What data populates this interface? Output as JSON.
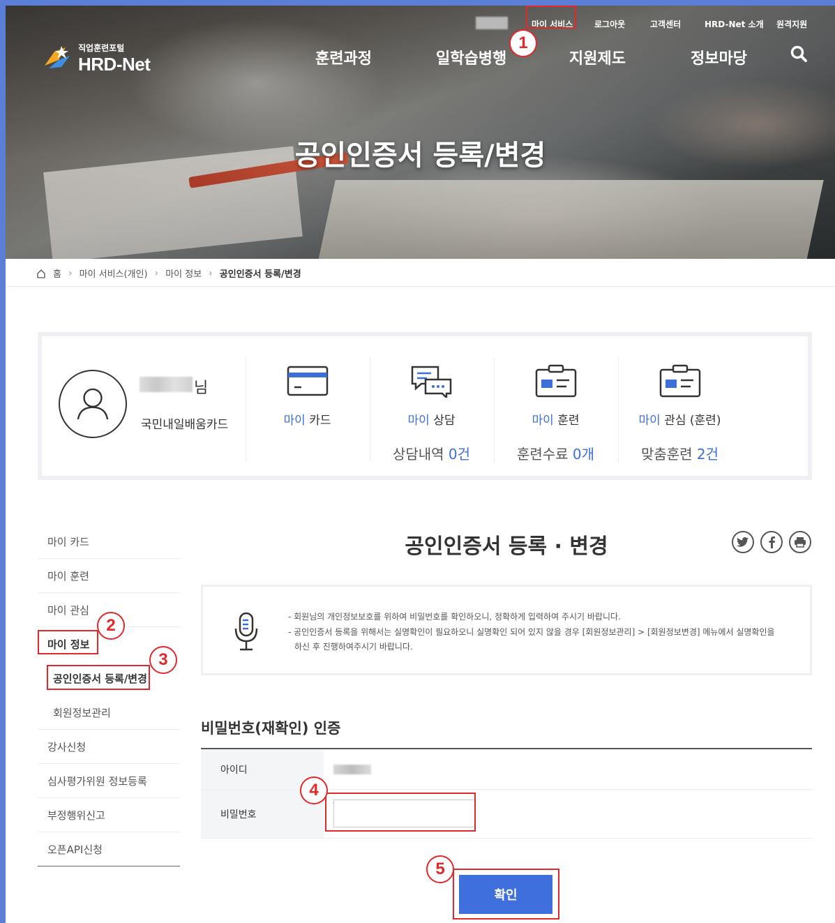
{
  "header": {
    "logo_sub": "직업훈련포털",
    "logo_main": "HRD-Net",
    "util_links": [
      "마이 서비스",
      "로그아웃",
      "고객센터",
      "HRD-Net 소개",
      "원격지원"
    ],
    "gnb": [
      "훈련과정",
      "일학습병행",
      "지원제도",
      "정보마당"
    ],
    "hero_title": "공인인증서 등록/변경"
  },
  "breadcrumb": {
    "home": "홈",
    "items": [
      "마이 서비스(개인)",
      "마이 정보",
      "공인인증서 등록/변경"
    ]
  },
  "profile": {
    "name_suffix": "님",
    "card_type": "국민내일배움카드"
  },
  "summary": [
    {
      "accent": "마이",
      "label": "카드",
      "icon": "card-icon",
      "stat": "",
      "count": ""
    },
    {
      "accent": "마이",
      "label": "상담",
      "icon": "chat-icon",
      "stat": "상담내역",
      "count": "0건"
    },
    {
      "accent": "마이",
      "label": "훈련",
      "icon": "id-card-icon",
      "stat": "훈련수료",
      "count": "0개"
    },
    {
      "accent": "마이",
      "label": "관심 (훈련)",
      "icon": "id-card-icon",
      "stat": "맞춤훈련",
      "count": "2건"
    }
  ],
  "lnb": {
    "items": [
      "마이 카드",
      "마이 훈련",
      "마이 관심",
      "마이 정보",
      "공인인증서 등록/변경",
      "회원정보관리",
      "강사신청",
      "심사평가위원 정보등록",
      "부정행위신고",
      "오픈API신청"
    ]
  },
  "content": {
    "title": "공인인증서 등록 · 변경",
    "notice1": "- 회원님의 개인정보보호를 위하여 비밀번호를 확인하오니, 정확하게 입력하여 주시기 바랍니다.",
    "notice2a": "- 공인인증서 등록을 위해서는 실명확인이 필요하오니 실명확인 되어 있지 않을 경우 [회원정보관리] > [회원정보변경] 메뉴에서 실명확인을",
    "notice2b": "하신 후 진행하여주시기 바랍니다.",
    "section_title": "비밀번호(재확인) 인증",
    "id_label": "아이디",
    "pw_label": "비밀번호",
    "pw_value": "",
    "confirm": "확인"
  },
  "callouts": [
    "1",
    "2",
    "3",
    "4",
    "5"
  ],
  "colors": {
    "accent": "#3d6fd6",
    "button": "#3f6fdc",
    "callout": "#e3282b"
  }
}
